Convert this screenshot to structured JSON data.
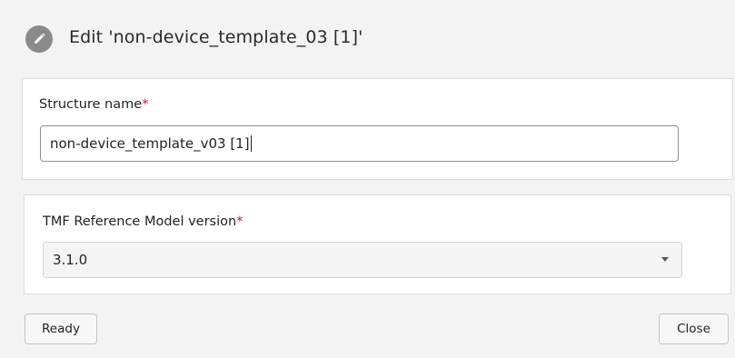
{
  "dialog": {
    "title": "Edit 'non-device_template_03 [1]'",
    "icon": "pencil-icon"
  },
  "structure_name": {
    "label": "Structure name",
    "required_marker": "*",
    "value": "non-device_template_v03 [1]"
  },
  "tmf_version": {
    "label": "TMF Reference Model version",
    "required_marker": "*",
    "selected": "3.1.0",
    "dropdown_icon": "chevron-down-icon"
  },
  "buttons": {
    "ready": "Ready",
    "close": "Close"
  },
  "colors": {
    "required": "#c8102e",
    "icon_circle": "#8a8a8a",
    "background": "#f3f3f3"
  }
}
